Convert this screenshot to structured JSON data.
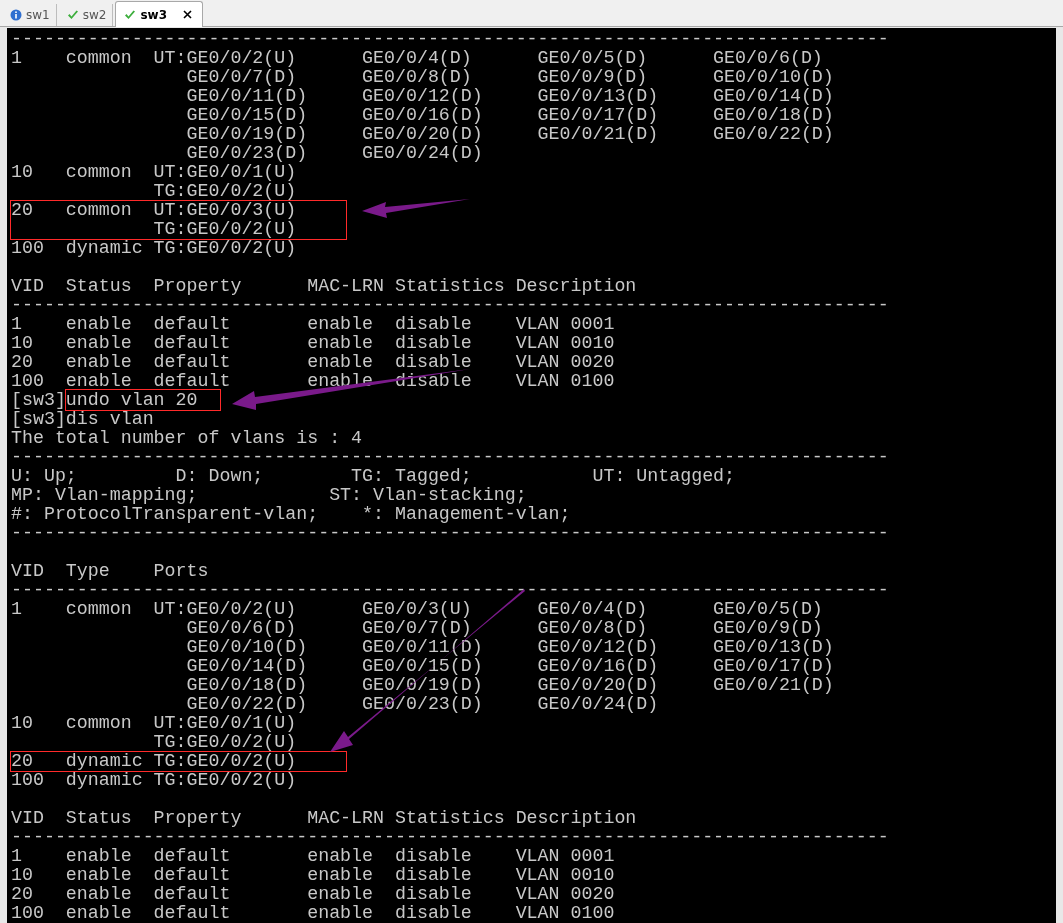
{
  "tabs": [
    {
      "label": "sw1",
      "kind": "info",
      "selected": false
    },
    {
      "label": "sw2",
      "kind": "check",
      "selected": false
    },
    {
      "label": "sw3",
      "kind": "check",
      "selected": true
    }
  ],
  "terminal": {
    "lines": [
      {
        "kind": "rule",
        "text": "--------------------------------------------------------------------------------"
      },
      {
        "kind": "output",
        "text": "1    common  UT:GE0/0/2(U)      GE0/0/4(D)      GE0/0/5(D)      GE0/0/6(D)"
      },
      {
        "kind": "output",
        "text": "                GE0/0/7(D)      GE0/0/8(D)      GE0/0/9(D)      GE0/0/10(D)"
      },
      {
        "kind": "output",
        "text": "                GE0/0/11(D)     GE0/0/12(D)     GE0/0/13(D)     GE0/0/14(D)"
      },
      {
        "kind": "output",
        "text": "                GE0/0/15(D)     GE0/0/16(D)     GE0/0/17(D)     GE0/0/18(D)"
      },
      {
        "kind": "output",
        "text": "                GE0/0/19(D)     GE0/0/20(D)     GE0/0/21(D)     GE0/0/22(D)"
      },
      {
        "kind": "output",
        "text": "                GE0/0/23(D)     GE0/0/24(D)"
      },
      {
        "kind": "output",
        "text": "10   common  UT:GE0/0/1(U)"
      },
      {
        "kind": "output",
        "text": "             TG:GE0/0/2(U)"
      },
      {
        "kind": "output",
        "text": "20   common  UT:GE0/0/3(U)",
        "boxed": true
      },
      {
        "kind": "output",
        "text": "             TG:GE0/0/2(U)",
        "boxed": true
      },
      {
        "kind": "output",
        "text": "100  dynamic TG:GE0/0/2(U)"
      },
      {
        "kind": "blank"
      },
      {
        "kind": "output",
        "text": "VID  Status  Property      MAC-LRN Statistics Description"
      },
      {
        "kind": "rule",
        "text": "--------------------------------------------------------------------------------"
      },
      {
        "kind": "output",
        "text": "1    enable  default       enable  disable    VLAN 0001"
      },
      {
        "kind": "output",
        "text": "10   enable  default       enable  disable    VLAN 0010"
      },
      {
        "kind": "output",
        "text": "20   enable  default       enable  disable    VLAN 0020"
      },
      {
        "kind": "output",
        "text": "100  enable  default       enable  disable    VLAN 0100"
      },
      {
        "kind": "command",
        "prompt": "[sw3]",
        "text": "undo vlan 20",
        "boxed": true
      },
      {
        "kind": "command",
        "prompt": "[sw3]",
        "text": "dis vlan"
      },
      {
        "kind": "output",
        "text": "The total number of vlans is : 4"
      },
      {
        "kind": "rule",
        "text": "--------------------------------------------------------------------------------"
      },
      {
        "kind": "output",
        "text": "U: Up;         D: Down;        TG: Tagged;           UT: Untagged;"
      },
      {
        "kind": "output",
        "text": "MP: Vlan-mapping;            ST: Vlan-stacking;"
      },
      {
        "kind": "output",
        "text": "#: ProtocolTransparent-vlan;    *: Management-vlan;"
      },
      {
        "kind": "rule",
        "text": "--------------------------------------------------------------------------------"
      },
      {
        "kind": "blank"
      },
      {
        "kind": "output",
        "text": "VID  Type    Ports"
      },
      {
        "kind": "rule",
        "text": "--------------------------------------------------------------------------------"
      },
      {
        "kind": "output",
        "text": "1    common  UT:GE0/0/2(U)      GE0/0/3(U)      GE0/0/4(D)      GE0/0/5(D)"
      },
      {
        "kind": "output",
        "text": "                GE0/0/6(D)      GE0/0/7(D)      GE0/0/8(D)      GE0/0/9(D)"
      },
      {
        "kind": "output",
        "text": "                GE0/0/10(D)     GE0/0/11(D)     GE0/0/12(D)     GE0/0/13(D)"
      },
      {
        "kind": "output",
        "text": "                GE0/0/14(D)     GE0/0/15(D)     GE0/0/16(D)     GE0/0/17(D)"
      },
      {
        "kind": "output",
        "text": "                GE0/0/18(D)     GE0/0/19(D)     GE0/0/20(D)     GE0/0/21(D)"
      },
      {
        "kind": "output",
        "text": "                GE0/0/22(D)     GE0/0/23(D)     GE0/0/24(D)"
      },
      {
        "kind": "output",
        "text": "10   common  UT:GE0/0/1(U)"
      },
      {
        "kind": "output",
        "text": "             TG:GE0/0/2(U)"
      },
      {
        "kind": "output",
        "text": "20   dynamic TG:GE0/0/2(U)",
        "boxed": true
      },
      {
        "kind": "output",
        "text": "100  dynamic TG:GE0/0/2(U)"
      },
      {
        "kind": "blank"
      },
      {
        "kind": "output",
        "text": "VID  Status  Property      MAC-LRN Statistics Description"
      },
      {
        "kind": "rule",
        "text": "--------------------------------------------------------------------------------"
      },
      {
        "kind": "output",
        "text": "1    enable  default       enable  disable    VLAN 0001"
      },
      {
        "kind": "output",
        "text": "10   enable  default       enable  disable    VLAN 0010"
      },
      {
        "kind": "output",
        "text": "20   enable  default       enable  disable    VLAN 0020"
      },
      {
        "kind": "output",
        "text": "100  enable  default       enable  disable    VLAN 0100"
      }
    ]
  }
}
